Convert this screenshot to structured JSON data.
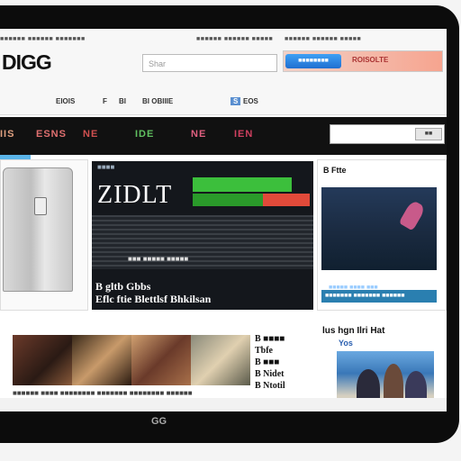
{
  "top_links": [
    "■■■■■■ ■■■■■■ ■■■■■■■",
    "■■■■■■ ■■■■■■ ■■■■■",
    "■■■■■■ ■■■■■■ ■■■■■"
  ],
  "logo": "DIGG",
  "search": {
    "placeholder": "Shar"
  },
  "banner": {
    "button": "■■■■■■■■",
    "text": "ROISOLTE"
  },
  "nav": {
    "item1": "EIOIS",
    "item2": "F",
    "item3": "BI",
    "item4": "BI OBIIIE",
    "tab": "S",
    "item5": "EOS"
  },
  "categories": [
    {
      "label": "IIS",
      "color": "#e0a080"
    },
    {
      "label": "ESNS",
      "color": "#e07070"
    },
    {
      "label": "NE",
      "color": "#d05050"
    },
    {
      "label": "IDE",
      "color": "#60c060"
    },
    {
      "label": "NE",
      "color": "#e06080"
    },
    {
      "label": "IEN",
      "color": "#d04060"
    }
  ],
  "cat_search": {
    "button": "■■"
  },
  "feature": {
    "label": "■■■■",
    "title": "ZIDLT",
    "stats": "■■■  ■■■■■  ■■■■■",
    "caption_line1": "B gltb Gbbs",
    "caption_line2": "Eflc ftie Blettlsf Bhkilsan"
  },
  "sidebar": {
    "title": "B Ftte",
    "caption": "■■■■■ ■■■■ ■■■",
    "blue_bar": "■■■■■■■ ■■■■■■■ ■■■■■■"
  },
  "thumbs_caption": "■■■■■■ ■■■■ ■■■■■■■■ ■■■■■■■ ■■■■■■■■ ■■■■■■",
  "side_list": [
    "B ■■■■",
    "Tbfe",
    "B ■■■",
    "B Nidet",
    "B Ntotil"
  ],
  "news": {
    "title": "lus hgn Ilri Hat",
    "sub": "Yos"
  },
  "home_label": "GG"
}
